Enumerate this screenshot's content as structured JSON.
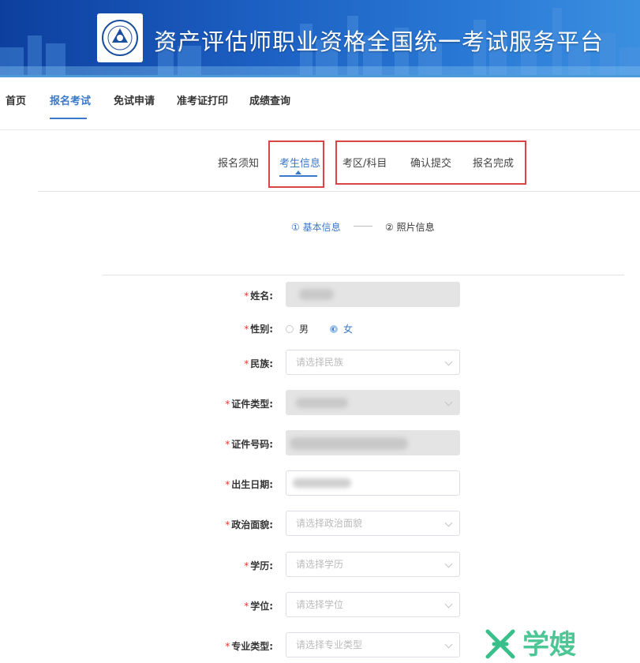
{
  "banner": {
    "title": "资产评估师职业资格全国统一考试服务平台"
  },
  "topnav": {
    "items": [
      "首页",
      "报名考试",
      "免试申请",
      "准考证打印",
      "成绩查询"
    ],
    "active": "报名考试"
  },
  "steps": {
    "items": [
      "报名须知",
      "考生信息",
      "考区/科目",
      "确认提交",
      "报名完成"
    ],
    "active": "考生信息"
  },
  "substeps": {
    "step1": "① 基本信息",
    "step2": "② 照片信息"
  },
  "form": {
    "required_mark": "*",
    "name_label": "姓名:",
    "gender_label": "性别:",
    "gender_options": [
      "男",
      "女"
    ],
    "gender_selected": "女",
    "ethnicity_label": "民族:",
    "ethnicity_placeholder": "请选择民族",
    "id_type_label": "证件类型:",
    "id_number_label": "证件号码:",
    "birthdate_label": "出生日期:",
    "politics_label": "政治面貌:",
    "politics_placeholder": "请选择政治面貌",
    "education_label": "学历:",
    "education_placeholder": "请选择学历",
    "degree_label": "学位:",
    "degree_placeholder": "请选择学位",
    "major_type_label": "专业类型:",
    "major_type_placeholder": "请选择专业类型"
  },
  "watermark": {
    "text": "学嫂"
  },
  "colors": {
    "primary": "#3a78c9",
    "highlight_box": "#d94545",
    "required": "#e33333",
    "banner": "#1c5fc2"
  }
}
